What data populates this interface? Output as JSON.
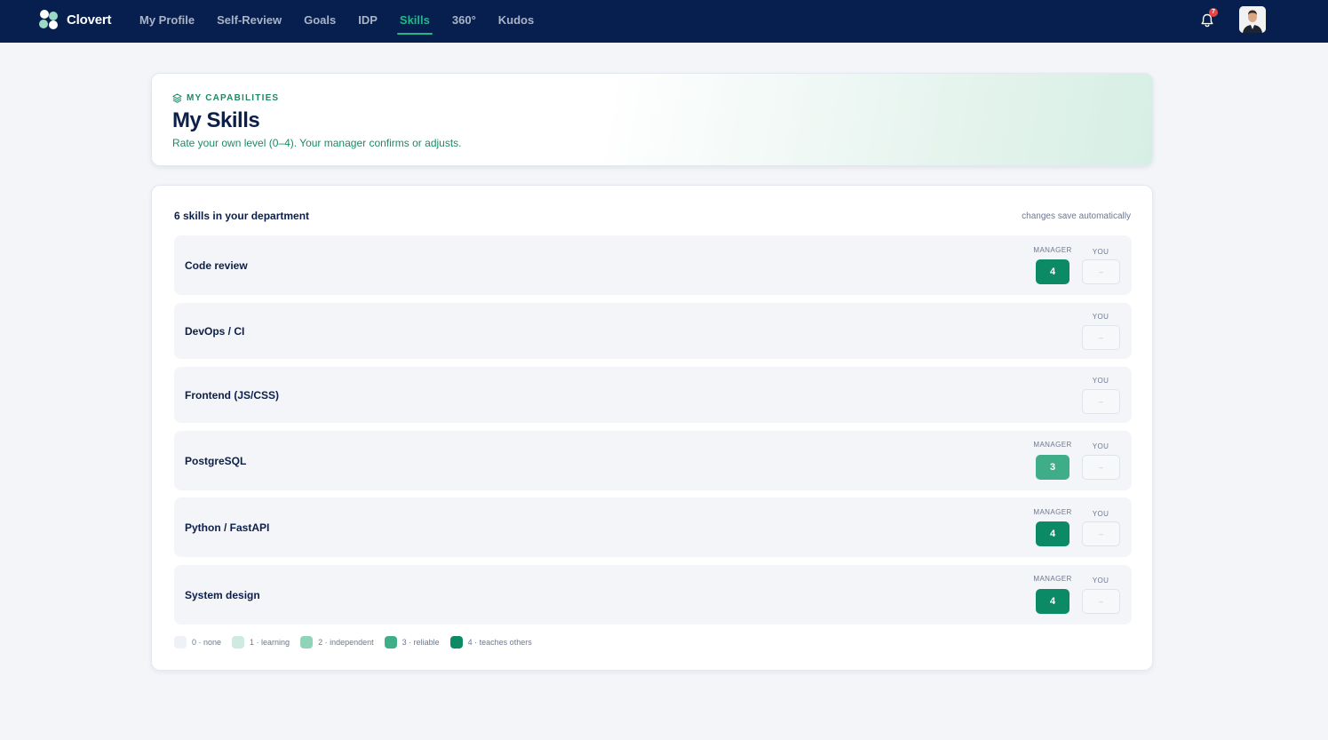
{
  "app": {
    "name": "Clovert"
  },
  "nav": {
    "items": [
      {
        "label": "My Profile",
        "active": false
      },
      {
        "label": "Self-Review",
        "active": false
      },
      {
        "label": "Goals",
        "active": false
      },
      {
        "label": "IDP",
        "active": false
      },
      {
        "label": "Skills",
        "active": true
      },
      {
        "label": "360°",
        "active": false
      },
      {
        "label": "Kudos",
        "active": false
      }
    ],
    "notifications_count": "7",
    "bell_icon": "bell-icon",
    "avatar_icon": "user-avatar"
  },
  "hero": {
    "eyebrow": "MY CAPABILITIES",
    "eyebrow_icon": "layers-icon",
    "title": "My Skills",
    "subtitle": "Rate your own level (0–4). Your manager confirms or adjusts."
  },
  "skills": {
    "heading": "6 skills in your department",
    "autosave_note": "changes save automatically",
    "manager_label": "MANAGER",
    "you_label": "YOU",
    "rows": [
      {
        "name": "Code review",
        "manager": "4",
        "you": "–"
      },
      {
        "name": "DevOps / CI",
        "manager": null,
        "you": "–"
      },
      {
        "name": "Frontend (JS/CSS)",
        "manager": null,
        "you": "–"
      },
      {
        "name": "PostgreSQL",
        "manager": "3",
        "you": "–"
      },
      {
        "name": "Python / FastAPI",
        "manager": "4",
        "you": "–"
      },
      {
        "name": "System design",
        "manager": "4",
        "you": "–"
      }
    ]
  },
  "legend": [
    {
      "label": "0 · none",
      "color": "#eef1f5"
    },
    {
      "label": "1 · learning",
      "color": "#cfeadf"
    },
    {
      "label": "2 · independent",
      "color": "#8fd3b8"
    },
    {
      "label": "3 · reliable",
      "color": "#3fae88"
    },
    {
      "label": "4 · teaches others",
      "color": "#0c8a66"
    }
  ],
  "colors": {
    "nav_bg": "#061f4f",
    "accent": "#22b88a",
    "level_3": "#3fae88",
    "level_4": "#0c8a66"
  }
}
